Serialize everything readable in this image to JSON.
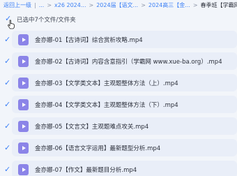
{
  "breadcrumb": {
    "back": "返回上一级",
    "items": [
      "...",
      "x26 2024...",
      "2024届【语文...",
      "2024高三【金...",
      "春季班【学霸网w..."
    ]
  },
  "selection": {
    "text": "已选中7个文件/文件夹"
  },
  "files": [
    {
      "name": "金亦娜-01【古诗词】综合赏析攻略.mp4",
      "icon": "video-file-icon"
    },
    {
      "name": "金亦娜-02【古诗词】内容含意指引（学霸网 www.xue-ba.org）.mp4",
      "icon": "video-file-icon"
    },
    {
      "name": "金亦娜-03【文学类文本】主观题整体方法（上）.mp4",
      "icon": "video-file-icon"
    },
    {
      "name": "金亦娜-04【文学类文本】主观题整体方法（下）.mp4",
      "icon": "video-file-icon"
    },
    {
      "name": "金亦娜-05【文言文】主观题难点攻关.mp4",
      "icon": "video-file-icon"
    },
    {
      "name": "金亦娜-06【语言文字运用】最新题型分析.mp4",
      "icon": "video-file-icon"
    },
    {
      "name": "金亦娜-07【作文】最新题目分析.mp4",
      "icon": "video-file-icon"
    }
  ],
  "colors": {
    "accent": "#3b7ff5",
    "video_icon": "#8b84e8",
    "row_selected": "#e9eef8"
  }
}
